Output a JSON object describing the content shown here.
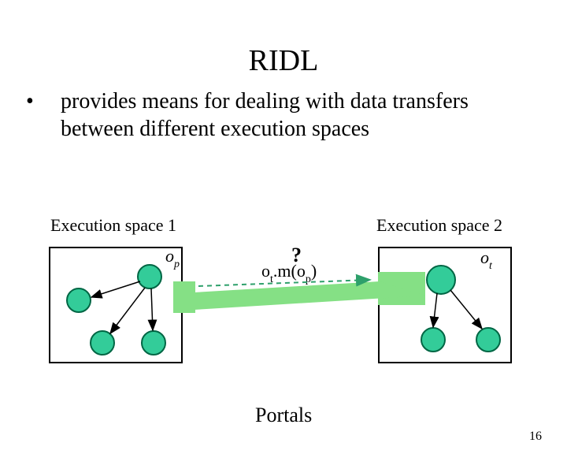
{
  "title": "RIDL",
  "bullet_text": "provides means for dealing with data transfers between different execution spaces",
  "space1_label": "Execution space 1",
  "space2_label": "Execution space 2",
  "op_label_base": "o",
  "op_label_sub": "p",
  "ot_label_base": "o",
  "ot_label_sub": "t",
  "question_mark": "?",
  "call_text_parts": {
    "pre": "o",
    "sub1": "t",
    "mid": ".m(o",
    "sub2": "p",
    "post": ")"
  },
  "footer": "Portals",
  "page_number": "16",
  "colors": {
    "node_fill": "#33cc99",
    "node_stroke": "#006644",
    "portal": "#85e085",
    "arrow": "#000000",
    "dashed": "#2ea06b"
  }
}
